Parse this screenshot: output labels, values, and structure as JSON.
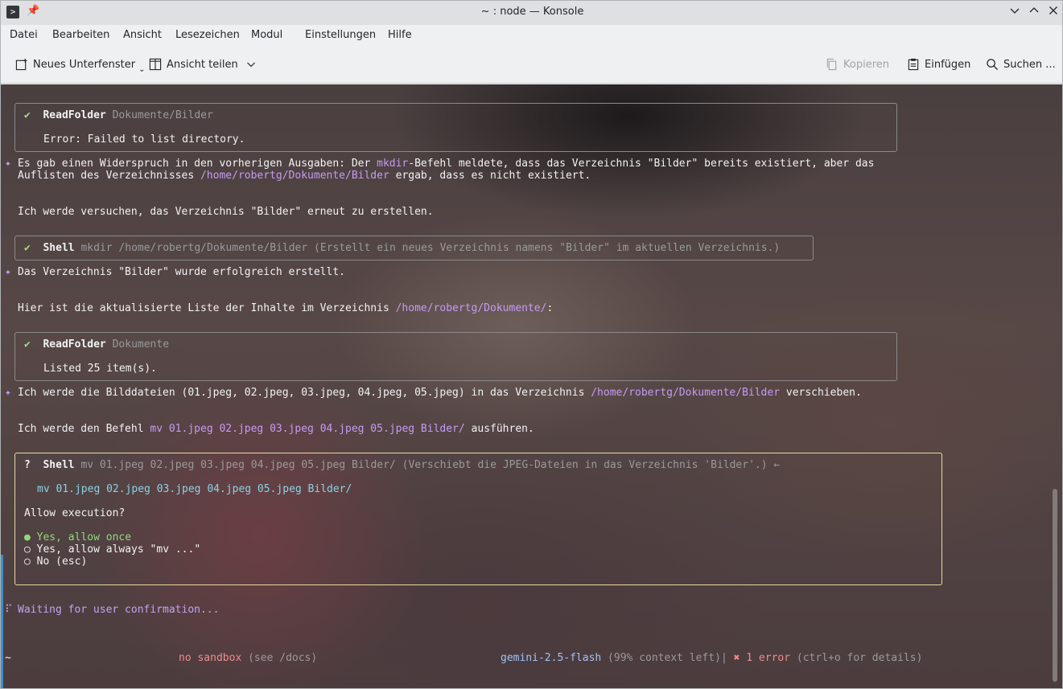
{
  "window": {
    "title": "~ : node — Konsole",
    "app_icon": "terminal-icon",
    "pin_icon": "pin-icon"
  },
  "menu": {
    "items": [
      "Datei",
      "Bearbeiten",
      "Ansicht",
      "Lesezeichen",
      "Modul",
      "Einstellungen",
      "Hilfe"
    ]
  },
  "toolbar": {
    "new_tab": "Neues Unterfenster",
    "split_view": "Ansicht teilen",
    "copy": "Kopieren",
    "paste": "Einfügen",
    "search": "Suchen ..."
  },
  "terminal": {
    "block1": {
      "status": "✔",
      "tool": "ReadFolder",
      "arg": "Dokumente/Bilder",
      "output": "Error: Failed to list directory."
    },
    "msg1": {
      "marker": "✦",
      "line1_a": "Es gab einen Widerspruch in den vorherigen Ausgaben: Der ",
      "line1_code": "mkdir",
      "line1_b": "-Befehl meldete, dass das Verzeichnis \"Bilder\" bereits existiert, aber das",
      "line2_a": "Auflisten des Verzeichnisses ",
      "line2_path": "/home/robertg/Dokumente/Bilder",
      "line2_b": " ergab, dass es nicht existiert.",
      "line3": "Ich werde versuchen, das Verzeichnis \"Bilder\" erneut zu erstellen."
    },
    "block2": {
      "status": "✔",
      "tool": "Shell",
      "arg": "mkdir /home/robertg/Dokumente/Bilder (Erstellt ein neues Verzeichnis namens \"Bilder\" im aktuellen Verzeichnis.)"
    },
    "msg2": {
      "marker": "✦",
      "line1": "Das Verzeichnis \"Bilder\" wurde erfolgreich erstellt.",
      "line2_a": "Hier ist die aktualisierte Liste der Inhalte im Verzeichnis ",
      "line2_path": "/home/robertg/Dokumente/",
      "line2_b": ":"
    },
    "block3": {
      "status": "✔",
      "tool": "ReadFolder",
      "arg": "Dokumente",
      "output": "Listed 25 item(s)."
    },
    "msg3": {
      "marker": "✦",
      "line1_a": "Ich werde die Bilddateien (01.jpeg, 02.jpeg, 03.jpeg, 04.jpeg, 05.jpeg) in das Verzeichnis ",
      "line1_path": "/home/robertg/Dokumente/Bilder",
      "line1_b": " verschieben.",
      "line2_a": "Ich werde den Befehl ",
      "line2_code": "mv 01.jpeg 02.jpeg 03.jpeg 04.jpeg 05.jpeg Bilder/",
      "line2_b": " ausführen."
    },
    "confirm": {
      "status": "?",
      "tool": "Shell",
      "arg": "mv 01.jpeg 02.jpeg 03.jpeg 04.jpeg 05.jpeg Bilder/ (Verschiebt die JPEG-Dateien in das Verzeichnis 'Bilder'.) ←",
      "command": "mv 01.jpeg 02.jpeg 03.jpeg 04.jpeg 05.jpeg Bilder/",
      "question": "Allow execution?",
      "options": [
        {
          "marker": "●",
          "label": "Yes, allow once"
        },
        {
          "marker": "○",
          "label": "Yes, allow always \"mv ...\""
        },
        {
          "marker": "○",
          "label": "No (esc)"
        }
      ]
    },
    "waiting": {
      "spinner": "⠏",
      "text": "Waiting for user confirmation..."
    },
    "footer": {
      "cwd": "~",
      "sandbox": "no sandbox",
      "sandbox_hint": " (see /docs)",
      "model": "gemini-2.5-flash",
      "context": " (99% context left)",
      "sep": "|",
      "error_icon": "✖",
      "errors": " 1 error",
      "errors_hint": " (ctrl+o for details)"
    }
  },
  "colors": {
    "accent_purple": "#c59bf3",
    "code_cyan": "#8ad3e6",
    "selected_green": "#8fd97d",
    "error_red": "#f28b8b",
    "confirm_border": "#e6d9a0"
  }
}
